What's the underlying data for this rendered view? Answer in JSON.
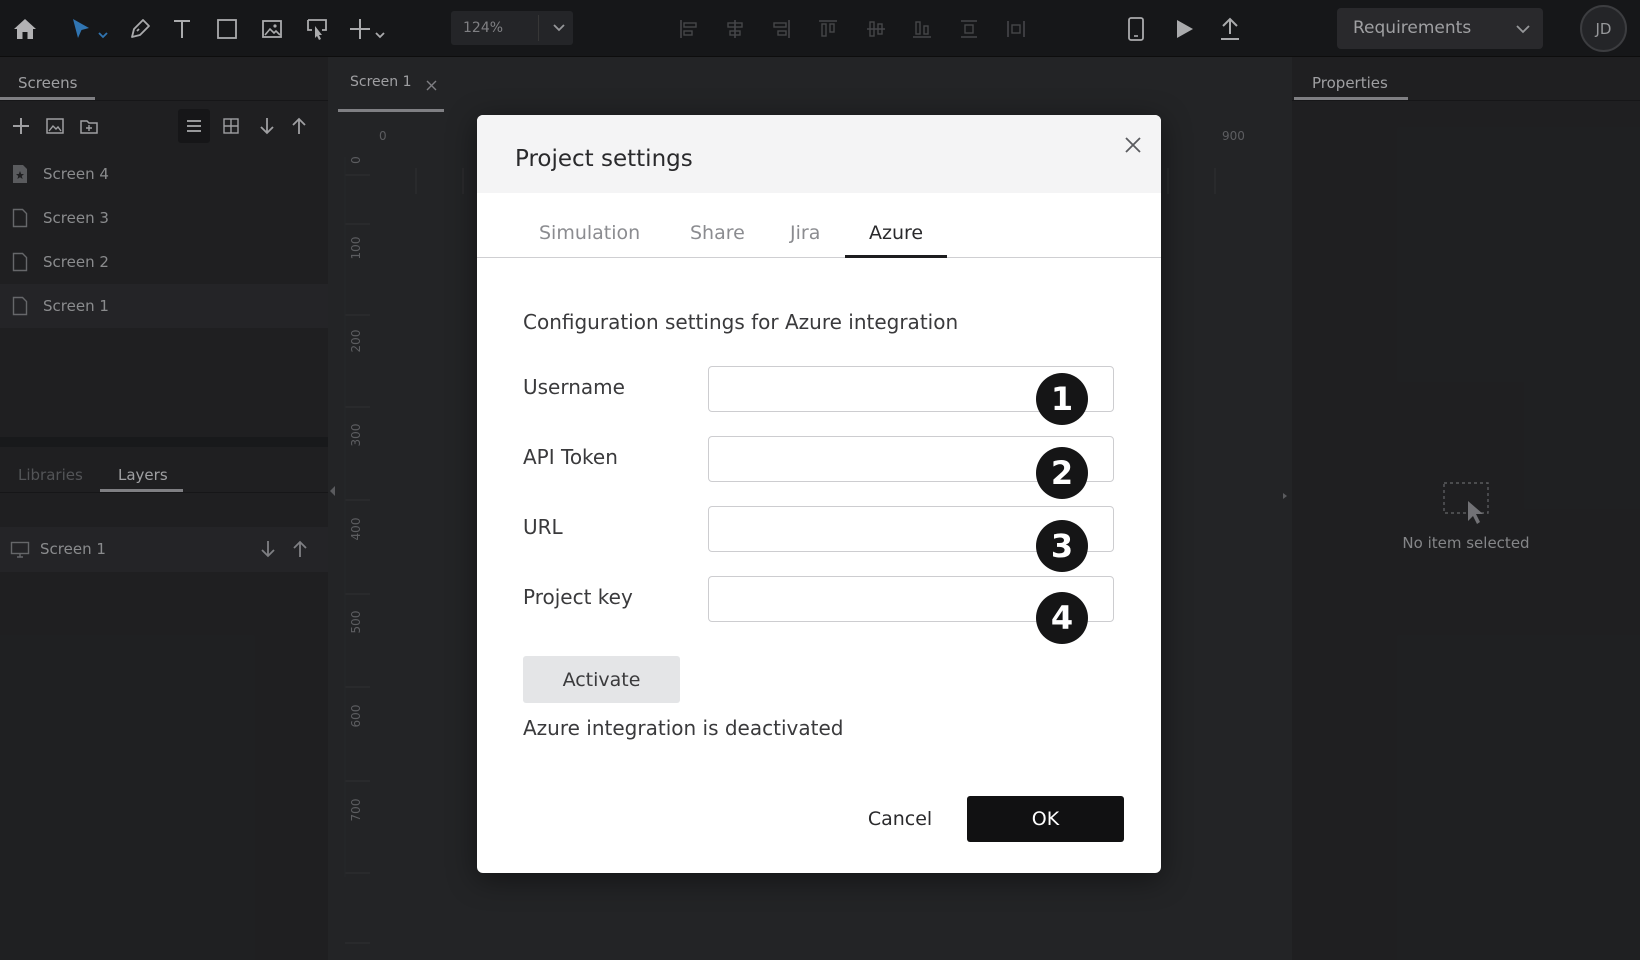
{
  "toolbar": {
    "zoom_value": "124%",
    "requirements_label": "Requirements",
    "avatar_initials": "JD"
  },
  "left_panel": {
    "screens_tab": "Screens",
    "screens": [
      {
        "label": "Screen 4",
        "icon": "starred-page-icon"
      },
      {
        "label": "Screen 3",
        "icon": "page-icon"
      },
      {
        "label": "Screen 2",
        "icon": "page-icon"
      },
      {
        "label": "Screen 1",
        "icon": "page-icon"
      }
    ],
    "libraries_tab": "Libraries",
    "layers_tab": "Layers",
    "layer_item": "Screen 1"
  },
  "canvas": {
    "doc_tab": "Screen 1",
    "ruler_top": [
      "0",
      "900"
    ],
    "ruler_left": [
      "0",
      "100",
      "200",
      "300",
      "400",
      "500",
      "600",
      "700"
    ]
  },
  "right_panel": {
    "properties_tab": "Properties",
    "empty_text": "No item selected"
  },
  "dialog": {
    "title": "Project settings",
    "tabs": [
      "Simulation",
      "Share",
      "Jira",
      "Azure"
    ],
    "active_tab": "Azure",
    "description": "Configuration settings for Azure integration",
    "fields": [
      {
        "label": "Username",
        "value": "",
        "badge": "1"
      },
      {
        "label": "API Token",
        "value": "",
        "badge": "2"
      },
      {
        "label": "URL",
        "value": "",
        "badge": "3"
      },
      {
        "label": "Project key",
        "value": "",
        "badge": "4"
      }
    ],
    "activate_label": "Activate",
    "status_text": "Azure integration is deactivated",
    "cancel_label": "Cancel",
    "ok_label": "OK"
  },
  "colors": {
    "toolbar_bg": "#1c1d1f",
    "panel_bg": "#262729",
    "select_tool": "#3b8fd9",
    "ok_button": "#111112",
    "badge": "#151516"
  }
}
